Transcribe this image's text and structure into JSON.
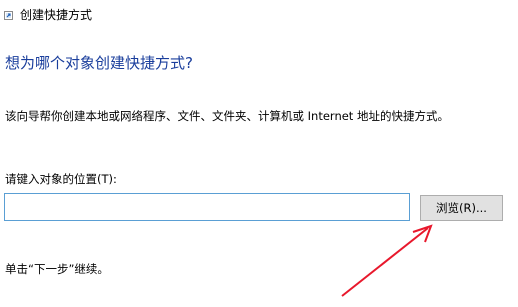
{
  "window": {
    "title": "创建快捷方式",
    "icon": "shortcut-wizard-icon"
  },
  "main": {
    "heading": "想为哪个对象创建快捷方式?",
    "description": "该向导帮你创建本地或网络程序、文件、文件夹、计算机或 Internet 地址的快捷方式。",
    "location_label": "请键入对象的位置(T):",
    "location_value": "",
    "browse_label": "浏览(R)...",
    "hint": "单击“下一步”继续。"
  },
  "colors": {
    "heading": "#1a3e9c",
    "input_border": "#5a9fd4",
    "button_bg": "#e1e1e1",
    "annotation_arrow": "#e8182c"
  }
}
